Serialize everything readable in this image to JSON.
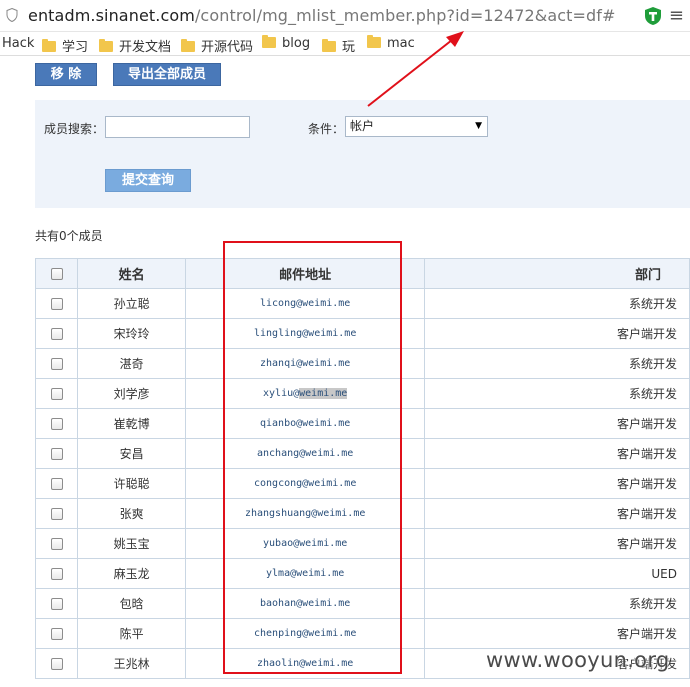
{
  "browser": {
    "url_host": "entadm.sinanet.com",
    "url_path": "/control/mg_mlist_member.php?id=12472&act=df#"
  },
  "bookmarks": [
    {
      "label": "Hack",
      "folder": false
    },
    {
      "label": "学习",
      "folder": true
    },
    {
      "label": "开发文档",
      "folder": true
    },
    {
      "label": "开源代码",
      "folder": true
    },
    {
      "label": "blog",
      "folder": true
    },
    {
      "label": "玩",
      "folder": true
    },
    {
      "label": "mac",
      "folder": true
    }
  ],
  "toolbar": {
    "remove_label": "移 除",
    "export_label": "导出全部成员"
  },
  "search": {
    "member_label": "成员搜索：",
    "member_value": "",
    "condition_label": "条件：",
    "condition_selected": "帐户",
    "submit_label": "提交查询"
  },
  "summary": {
    "count_text": "共有0个成员"
  },
  "table": {
    "headers": {
      "name": "姓名",
      "email": "邮件地址",
      "dept": "部门"
    },
    "rows": [
      {
        "name": "孙立聪",
        "email": "licong@weimi.me",
        "dept": "系统开发"
      },
      {
        "name": "宋玲玲",
        "email": "lingling@weimi.me",
        "dept": "客户端开发"
      },
      {
        "name": "湛奇",
        "email": "zhanqi@weimi.me",
        "dept": "系统开发"
      },
      {
        "name": "刘学彦",
        "email_pre": "xyliu@",
        "email_hl": "weimi.me",
        "dept": "系统开发"
      },
      {
        "name": "崔乾博",
        "email": "qianbo@weimi.me",
        "dept": "客户端开发"
      },
      {
        "name": "安昌",
        "email": "anchang@weimi.me",
        "dept": "客户端开发"
      },
      {
        "name": "许聪聪",
        "email": "congcong@weimi.me",
        "dept": "客户端开发"
      },
      {
        "name": "张爽",
        "email": "zhangshuang@weimi.me",
        "dept": "客户端开发"
      },
      {
        "name": "姚玉宝",
        "email": "yubao@weimi.me",
        "dept": "客户端开发"
      },
      {
        "name": "麻玉龙",
        "email": "ylma@weimi.me",
        "dept": "UED"
      },
      {
        "name": "包晗",
        "email": "baohan@weimi.me",
        "dept": "系统开发"
      },
      {
        "name": "陈平",
        "email": "chenping@weimi.me",
        "dept": "客户端开发"
      },
      {
        "name": "王兆林",
        "email": "zhaolin@weimi.me",
        "dept": "客户端开发"
      }
    ]
  },
  "watermark": "www.wooyun.org",
  "colors": {
    "primary_button": "#4a79b9",
    "panel_bg": "#eef3fa",
    "highlight_box": "#e0101a",
    "email_text": "#2a4f7a"
  }
}
